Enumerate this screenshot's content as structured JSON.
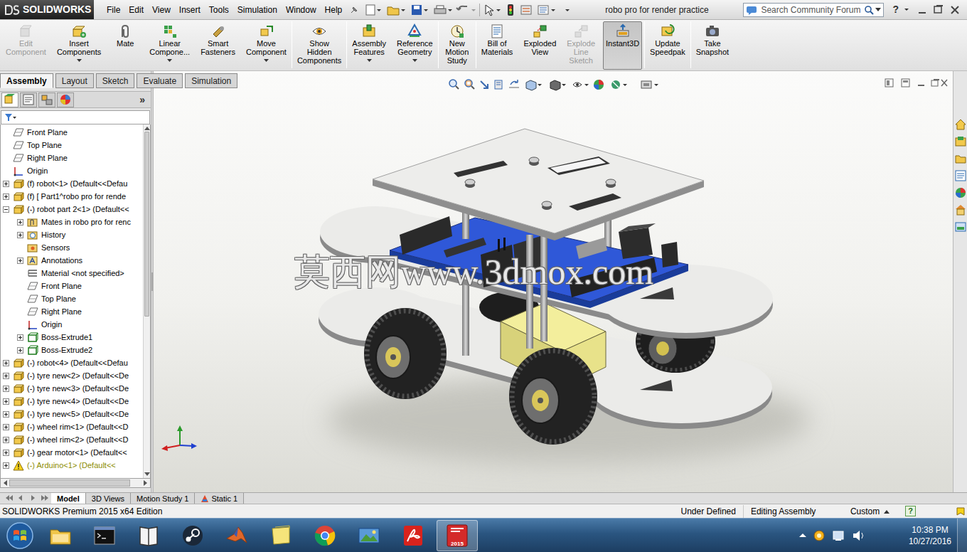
{
  "window": {
    "logo": "SOLIDWORKS",
    "title": "robo pro for render practice",
    "help": "?"
  },
  "menu": [
    "File",
    "Edit",
    "View",
    "Insert",
    "Tools",
    "Simulation",
    "Window",
    "Help"
  ],
  "search": {
    "placeholder": "Search Community Forum"
  },
  "command_manager": {
    "buttons": [
      {
        "lines": [
          "Edit",
          "Component"
        ],
        "disabled": true,
        "selected": false,
        "dropdown": false,
        "separator_after": false
      },
      {
        "lines": [
          "Insert",
          "Components"
        ],
        "disabled": false,
        "selected": false,
        "dropdown": true,
        "separator_after": false
      },
      {
        "lines": [
          "Mate"
        ],
        "disabled": false,
        "selected": false,
        "dropdown": false,
        "separator_after": false
      },
      {
        "lines": [
          "Linear",
          "Compone..."
        ],
        "disabled": false,
        "selected": false,
        "dropdown": true,
        "separator_after": false
      },
      {
        "lines": [
          "Smart",
          "Fasteners"
        ],
        "disabled": false,
        "selected": false,
        "dropdown": false,
        "separator_after": false
      },
      {
        "lines": [
          "Move",
          "Component"
        ],
        "disabled": false,
        "selected": false,
        "dropdown": true,
        "separator_after": true
      },
      {
        "lines": [
          "Show",
          "Hidden",
          "Components"
        ],
        "disabled": false,
        "selected": false,
        "dropdown": false,
        "separator_after": true
      },
      {
        "lines": [
          "Assembly",
          "Features"
        ],
        "disabled": false,
        "selected": false,
        "dropdown": true,
        "separator_after": false
      },
      {
        "lines": [
          "Reference",
          "Geometry"
        ],
        "disabled": false,
        "selected": false,
        "dropdown": true,
        "separator_after": true
      },
      {
        "lines": [
          "New",
          "Motion",
          "Study"
        ],
        "disabled": false,
        "selected": false,
        "dropdown": false,
        "separator_after": true
      },
      {
        "lines": [
          "Bill of",
          "Materials"
        ],
        "disabled": false,
        "selected": false,
        "dropdown": false,
        "separator_after": false
      },
      {
        "lines": [
          "Exploded",
          "View"
        ],
        "disabled": false,
        "selected": false,
        "dropdown": false,
        "separator_after": false
      },
      {
        "lines": [
          "Explode",
          "Line",
          "Sketch"
        ],
        "disabled": true,
        "selected": false,
        "dropdown": false,
        "separator_after": false
      },
      {
        "lines": [
          "Instant3D"
        ],
        "disabled": false,
        "selected": true,
        "dropdown": false,
        "separator_after": true
      },
      {
        "lines": [
          "Update",
          "Speedpak"
        ],
        "disabled": false,
        "selected": false,
        "dropdown": false,
        "separator_after": true
      },
      {
        "lines": [
          "Take",
          "Snapshot"
        ],
        "disabled": false,
        "selected": false,
        "dropdown": false,
        "separator_after": false
      }
    ]
  },
  "command_tabs": [
    {
      "label": "Assembly",
      "selected": true
    },
    {
      "label": "Layout",
      "selected": false
    },
    {
      "label": "Sketch",
      "selected": false
    },
    {
      "label": "Evaluate",
      "selected": false
    },
    {
      "label": "Simulation",
      "selected": false
    }
  ],
  "feature_manager": {
    "collapse_glyph": "»",
    "tree": [
      {
        "text": "Front Plane",
        "kind": "plane",
        "depth": 0,
        "expandable": false,
        "expanded": false,
        "warning": false
      },
      {
        "text": "Top Plane",
        "kind": "plane",
        "depth": 0,
        "expandable": false,
        "expanded": false,
        "warning": false
      },
      {
        "text": "Right Plane",
        "kind": "plane",
        "depth": 0,
        "expandable": false,
        "expanded": false,
        "warning": false
      },
      {
        "text": "Origin",
        "kind": "origin",
        "depth": 0,
        "expandable": false,
        "expanded": false,
        "warning": false
      },
      {
        "text": "(f) robot<1> (Default<<Defau",
        "kind": "component",
        "depth": 0,
        "expandable": true,
        "expanded": false,
        "warning": false
      },
      {
        "text": "(f) [ Part1^robo pro for rende",
        "kind": "component",
        "depth": 0,
        "expandable": true,
        "expanded": false,
        "warning": false
      },
      {
        "text": "(-) robot part 2<1> (Default<<",
        "kind": "component",
        "depth": 0,
        "expandable": true,
        "expanded": true,
        "warning": false
      },
      {
        "text": "Mates in robo pro for renc",
        "kind": "mates",
        "depth": 1,
        "expandable": true,
        "expanded": false,
        "warning": false
      },
      {
        "text": "History",
        "kind": "history",
        "depth": 1,
        "expandable": true,
        "expanded": false,
        "warning": false
      },
      {
        "text": "Sensors",
        "kind": "sensors",
        "depth": 1,
        "expandable": false,
        "expanded": false,
        "warning": false
      },
      {
        "text": "Annotations",
        "kind": "annotations",
        "depth": 1,
        "expandable": true,
        "expanded": false,
        "warning": false
      },
      {
        "text": "Material <not specified>",
        "kind": "material",
        "depth": 1,
        "expandable": false,
        "expanded": false,
        "warning": false
      },
      {
        "text": "Front Plane",
        "kind": "plane",
        "depth": 1,
        "expandable": false,
        "expanded": false,
        "warning": false
      },
      {
        "text": "Top Plane",
        "kind": "plane",
        "depth": 1,
        "expandable": false,
        "expanded": false,
        "warning": false
      },
      {
        "text": "Right Plane",
        "kind": "plane",
        "depth": 1,
        "expandable": false,
        "expanded": false,
        "warning": false
      },
      {
        "text": "Origin",
        "kind": "origin",
        "depth": 1,
        "expandable": false,
        "expanded": false,
        "warning": false
      },
      {
        "text": "Boss-Extrude1",
        "kind": "feature",
        "depth": 1,
        "expandable": true,
        "expanded": false,
        "warning": false
      },
      {
        "text": "Boss-Extrude2",
        "kind": "feature",
        "depth": 1,
        "expandable": true,
        "expanded": false,
        "warning": false
      },
      {
        "text": "(-) robot<4> (Default<<Defau",
        "kind": "component",
        "depth": 0,
        "expandable": true,
        "expanded": false,
        "warning": false
      },
      {
        "text": "(-) tyre new<2> (Default<<De",
        "kind": "component",
        "depth": 0,
        "expandable": true,
        "expanded": false,
        "warning": false
      },
      {
        "text": "(-) tyre new<3> (Default<<De",
        "kind": "component",
        "depth": 0,
        "expandable": true,
        "expanded": false,
        "warning": false
      },
      {
        "text": "(-) tyre new<4> (Default<<De",
        "kind": "component",
        "depth": 0,
        "expandable": true,
        "expanded": false,
        "warning": false
      },
      {
        "text": "(-) tyre new<5> (Default<<De",
        "kind": "component",
        "depth": 0,
        "expandable": true,
        "expanded": false,
        "warning": false
      },
      {
        "text": "(-) wheel rim<1> (Default<<D",
        "kind": "component",
        "depth": 0,
        "expandable": true,
        "expanded": false,
        "warning": false
      },
      {
        "text": "(-) wheel rim<2> (Default<<D",
        "kind": "component",
        "depth": 0,
        "expandable": true,
        "expanded": false,
        "warning": false
      },
      {
        "text": "(-) gear motor<1> (Default<<",
        "kind": "component",
        "depth": 0,
        "expandable": true,
        "expanded": false,
        "warning": false
      },
      {
        "text": "(-) Arduino<1> (Default<<",
        "kind": "component",
        "depth": 0,
        "expandable": true,
        "expanded": false,
        "warning": true
      }
    ]
  },
  "graphics": {
    "watermark": "莫西网www.3dmox.com"
  },
  "bottom_tabs": [
    {
      "label": "Model",
      "selected": true
    },
    {
      "label": "3D Views",
      "selected": false
    },
    {
      "label": "Motion Study 1",
      "selected": false
    },
    {
      "label": "Static 1",
      "selected": false
    }
  ],
  "status_bar": {
    "product": "SOLIDWORKS Premium 2015 x64 Edition",
    "state": "Under Defined",
    "mode": "Editing Assembly",
    "units": "Custom",
    "help": "?"
  },
  "taskbar": {
    "items": [
      {
        "kind": "explorer",
        "active": false
      },
      {
        "kind": "cmd",
        "active": false
      },
      {
        "kind": "book",
        "active": false
      },
      {
        "kind": "steam",
        "active": false
      },
      {
        "kind": "matlab",
        "active": false
      },
      {
        "kind": "sticky",
        "active": false
      },
      {
        "kind": "chrome",
        "active": false
      },
      {
        "kind": "photos",
        "active": false
      },
      {
        "kind": "acrobat",
        "active": false
      },
      {
        "kind": "solidworks",
        "active": true,
        "label": "2015"
      }
    ],
    "time": "10:38 PM",
    "date": "10/27/2016"
  }
}
